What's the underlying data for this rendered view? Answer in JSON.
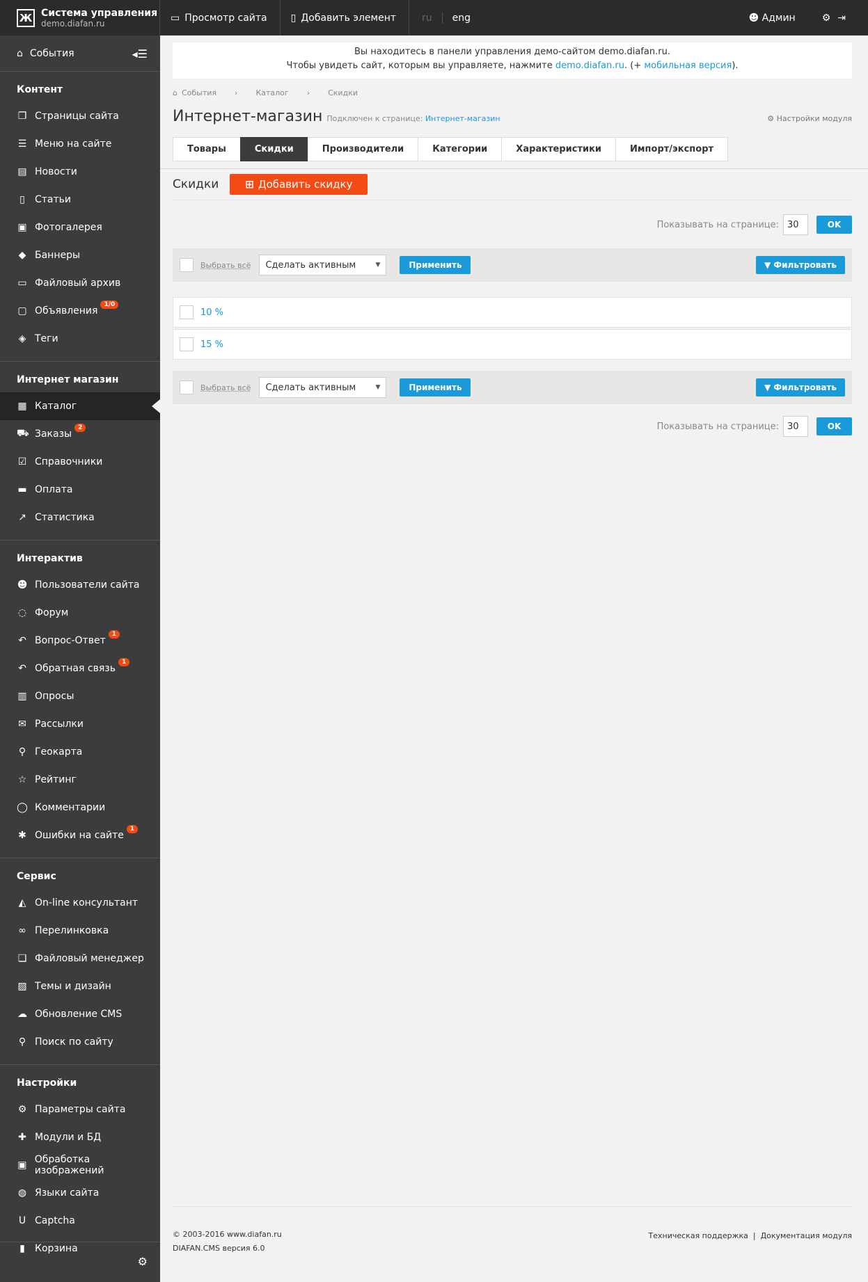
{
  "brand": {
    "title": "Система управления",
    "subtitle": "demo.diafan.ru",
    "logo_letter": "Ж"
  },
  "topbar": {
    "view_site": "Просмотр сайта",
    "add_element": "Добавить элемент",
    "lang_ru": "ru",
    "lang_eng": "eng",
    "user": "Админ"
  },
  "sidebar": {
    "events": "События",
    "groups": [
      {
        "title": "Контент",
        "items": [
          {
            "label": "Страницы сайта",
            "icon": "pages-icon",
            "glyph": "❐"
          },
          {
            "label": "Меню на сайте",
            "icon": "menu-icon",
            "glyph": "☰"
          },
          {
            "label": "Новости",
            "icon": "news-icon",
            "glyph": "▤"
          },
          {
            "label": "Статьи",
            "icon": "article-icon",
            "glyph": "▯"
          },
          {
            "label": "Фотогалерея",
            "icon": "photo-icon",
            "glyph": "▣"
          },
          {
            "label": "Баннеры",
            "icon": "tag-icon",
            "glyph": "◆"
          },
          {
            "label": "Файловый архив",
            "icon": "folder-icon",
            "glyph": "▭"
          },
          {
            "label": "Объявления",
            "icon": "ads-icon",
            "glyph": "▢",
            "badge": "1/0"
          },
          {
            "label": "Теги",
            "icon": "tags-icon",
            "glyph": "◈"
          }
        ]
      },
      {
        "title": "Интернет магазин",
        "items": [
          {
            "label": "Каталог",
            "icon": "grid-icon",
            "glyph": "▦",
            "active": true
          },
          {
            "label": "Заказы",
            "icon": "cart-icon",
            "glyph": "⛟",
            "badge": "2"
          },
          {
            "label": "Справочники",
            "icon": "check-icon",
            "glyph": "☑"
          },
          {
            "label": "Оплата",
            "icon": "card-icon",
            "glyph": "▬"
          },
          {
            "label": "Статистика",
            "icon": "chart-icon",
            "glyph": "↗"
          }
        ]
      },
      {
        "title": "Интерактив",
        "items": [
          {
            "label": "Пользователи сайта",
            "icon": "users-icon",
            "glyph": "☻"
          },
          {
            "label": "Форум",
            "icon": "forum-icon",
            "glyph": "◌"
          },
          {
            "label": "Вопрос-Ответ",
            "icon": "reply-icon",
            "glyph": "↶",
            "badge": "1"
          },
          {
            "label": "Обратная связь",
            "icon": "feedback-icon",
            "glyph": "↶",
            "badge": "1"
          },
          {
            "label": "Опросы",
            "icon": "poll-icon",
            "glyph": "▥"
          },
          {
            "label": "Рассылки",
            "icon": "mail-icon",
            "glyph": "✉"
          },
          {
            "label": "Геокарта",
            "icon": "map-marker-icon",
            "glyph": "⚲"
          },
          {
            "label": "Рейтинг",
            "icon": "star-icon",
            "glyph": "☆"
          },
          {
            "label": "Комментарии",
            "icon": "comment-icon",
            "glyph": "◯"
          },
          {
            "label": "Ошибки на сайте",
            "icon": "bug-icon",
            "glyph": "✱",
            "badge": "1"
          }
        ]
      },
      {
        "title": "Сервис",
        "items": [
          {
            "label": "On-line консультант",
            "icon": "graduation-icon",
            "glyph": "◭"
          },
          {
            "label": "Перелинковка",
            "icon": "link-icon",
            "glyph": "∞"
          },
          {
            "label": "Файловый менеджер",
            "icon": "file-manager-icon",
            "glyph": "❏"
          },
          {
            "label": "Темы и дизайн",
            "icon": "design-icon",
            "glyph": "▨"
          },
          {
            "label": "Обновление CMS",
            "icon": "cloud-icon",
            "glyph": "☁"
          },
          {
            "label": "Поиск по сайту",
            "icon": "search-icon",
            "glyph": "⚲"
          }
        ]
      },
      {
        "title": "Настройки",
        "items": [
          {
            "label": "Параметры сайта",
            "icon": "cogs-icon",
            "glyph": "⚙"
          },
          {
            "label": "Модули и БД",
            "icon": "puzzle-icon",
            "glyph": "✚"
          },
          {
            "label": "Обработка изображений",
            "icon": "image-icon",
            "glyph": "▣"
          },
          {
            "label": "Языки сайта",
            "icon": "globe-icon",
            "glyph": "◍"
          },
          {
            "label": "Captcha",
            "icon": "captcha-icon",
            "glyph": "U"
          },
          {
            "label": "Корзина",
            "icon": "trash-icon",
            "glyph": "▮"
          }
        ]
      }
    ]
  },
  "notice": {
    "line1": "Вы находитесь в панели управления демо-сайтом demo.diafan.ru.",
    "line2_prefix": "Чтобы увидеть сайт, которым вы управляете, нажмите",
    "line2_link": "demo.diafan.ru",
    "line2_mid": ". (+",
    "line2_link2": "мобильная версия",
    "line2_suffix": ")."
  },
  "breadcrumb": [
    "События",
    "Каталог",
    "Скидки"
  ],
  "page": {
    "title": "Интернет-магазин",
    "connected_label": "Подключен к странице:",
    "connected_link": "Интернет-магазин",
    "module_settings": "Настройки модуля"
  },
  "tabs": [
    {
      "label": "Товары"
    },
    {
      "label": "Скидки",
      "active": true
    },
    {
      "label": "Производители"
    },
    {
      "label": "Категории"
    },
    {
      "label": "Характеристики"
    },
    {
      "label": "Импорт/экспорт"
    }
  ],
  "section": {
    "title": "Скидки",
    "add_button": "Добавить скидку"
  },
  "per_page": {
    "label": "Показывать на странице:",
    "value": "30",
    "ok": "OK"
  },
  "actions": {
    "select_all": "Выбрать всё",
    "select_value": "Сделать активным",
    "apply": "Применить",
    "filter": "Фильтровать"
  },
  "rows": [
    "10 %",
    "15 %"
  ],
  "footer": {
    "copyright": "© 2003-2016 www.diafan.ru",
    "version": "DIAFAN.CMS версия 6.0",
    "support": "Техническая поддержка",
    "docs": "Документация модуля"
  }
}
